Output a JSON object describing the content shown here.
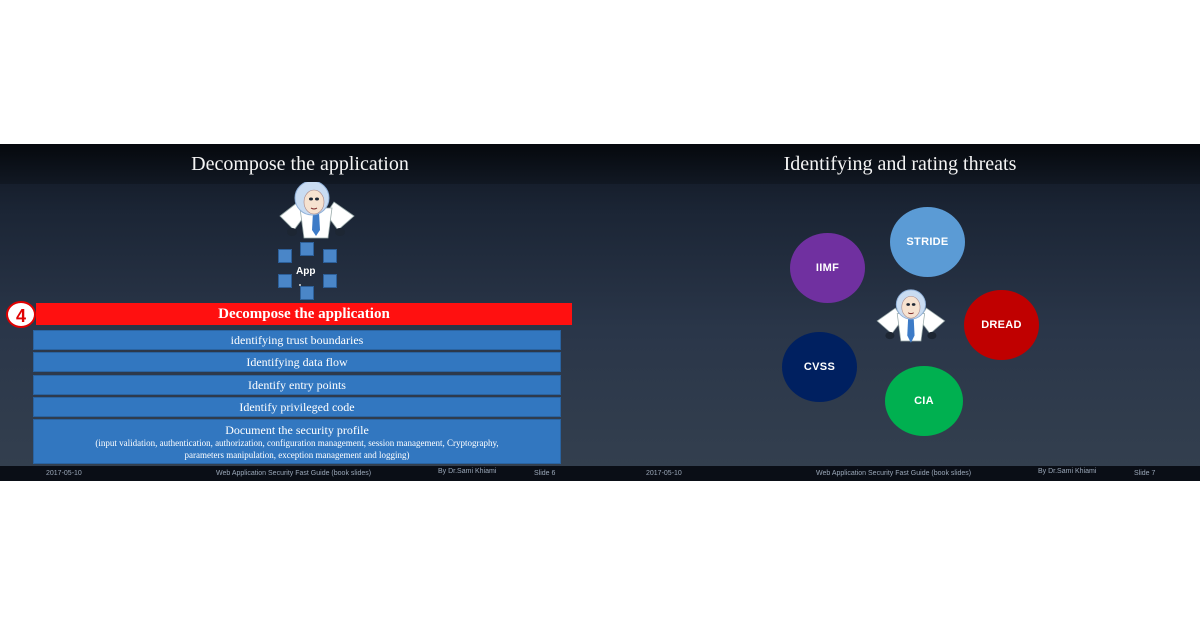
{
  "slides": [
    {
      "title": "Decompose the application",
      "app_label": "App",
      "step_number": "4",
      "heading_bar": "Decompose the application",
      "items": [
        "identifying trust boundaries",
        "Identifying data flow",
        "Identify entry points",
        "Identify privileged code"
      ],
      "profile": {
        "title": "Document the security profile",
        "detail_line1": "(input validation, authentication, authorization, configuration management, session management, Cryptography,",
        "detail_line2": "parameters manipulation, exception management and logging)"
      },
      "footer": {
        "date": "2017-05-10",
        "title": "Web Application Security  Fast Guide (book slides)",
        "author": "By Dr.Sami Khiami",
        "slide": "Slide 6"
      }
    },
    {
      "title": "Identifying and rating threats",
      "circles": [
        {
          "label": "STRIDE",
          "color": "#5b9bd5"
        },
        {
          "label": "IIMF",
          "color": "#7030a0"
        },
        {
          "label": "DREAD",
          "color": "#c00000"
        },
        {
          "label": "CVSS",
          "color": "#002060"
        },
        {
          "label": "CIA",
          "color": "#00b050"
        }
      ],
      "footer": {
        "date": "2017-05-10",
        "title": "Web Application Security  Fast Guide (book slides)",
        "author": "By Dr.Sami Khiami",
        "slide": "Slide 7"
      }
    }
  ],
  "icons": [
    "character-icon",
    "module-square-icon"
  ]
}
